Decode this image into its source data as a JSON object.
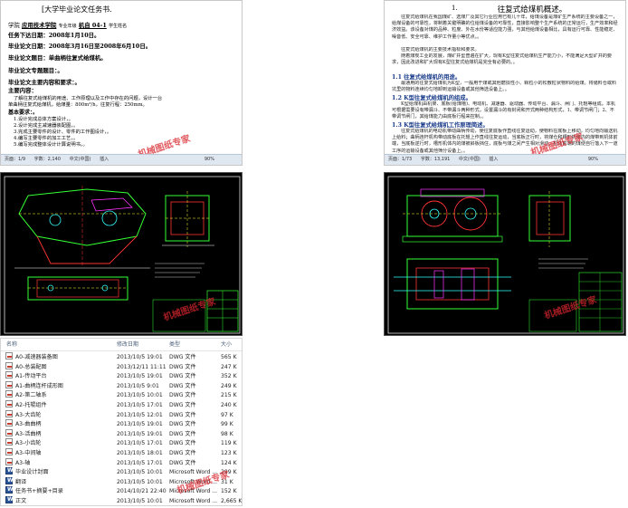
{
  "top_left_doc": {
    "title": "[大学毕业论文任务书.",
    "lines": [
      {
        "label": "学院",
        "value": "应用技术学院",
        "label2": "专业年级",
        "value2": "机自 04-1",
        "label3": "学生姓名"
      },
      {
        "text": "任务下达日期：2008年1月10日。"
      },
      {
        "text": "毕业论文日期：2008年3月16日至2008年6月10日。"
      },
      {
        "text": "毕业论文题目：单曲柄往复式给煤机。"
      },
      {
        "text": "毕业论文专题题目：。"
      },
      {
        "text": "毕业论文主要内容和要求：。"
      },
      {
        "text": "主要内容："
      }
    ],
    "content_lines": [
      "了解往复式给煤机的用途、工作原理以及工作中存在的问题，设计一台",
      "单曲柄往复式给煤机，给煤量：800m³/h，往复行程：250mm。"
    ],
    "requirements_head": "基本要求：。",
    "requirements": [
      "1.设计完成总体方案设计，。",
      "2.设计完成主减速器装配图，。",
      "3.完成主要零件的设计、零件的工作图设计，。",
      "4.编写主要零件的加工工艺，。",
      "5.编写完成整体设计计算说明书。。"
    ],
    "status": [
      "页面：1/9",
      "字数：2,140",
      "中文(中国)",
      "插入",
      "90%"
    ]
  },
  "top_right_doc": {
    "page_marker": "1.",
    "title": "往复式给煤机概述。",
    "para1": "往复式给煤机在我国煤矿、选煤厂及其它行业应用已有几十年，给煤设备是煤矿生产系统的主要设备之一，给煤设备的可靠性，将制着关键明确的位给煤设备的可靠性，直接影响整个生产系统的正常运行，生产效率和经济效益。该设备对煤的品种、粒度、外在水份等适应能力强，与其他给煤设备相比，具有运行可靠、性能稳定、噪音低、安全可靠、维护工作量小等优点。。",
    "para2": "往复式给煤机的主要技术指标和要求。",
    "para3": "随着煤炭工业的发展，煤矿井型普遍在扩大，现有K型往复式给煤机生产能力小，不能满足大型矿井的要求，因此改进和扩大现有K型往复式给煤机是完全有必要的。。",
    "h1": "1.1 往复式给煤机的用途。",
    "para4": "最通用的往复式给煤机为K型，一般用于煤或其他磨损性小、颗粒小的松散粒状物料的给煤。将储料仓或料坑里的物料连续均匀地卸到运输设备或其他筛选设备上。。",
    "h2": "1.2 K型往复式给煤机的组成。",
    "para5": "K型给煤机由机架、底板(给煤槽)、电动机、减速器、驱动器、传动平台、漏斗、闸门、托辊等组成。本机可根据需要设有带漏斗、不带漏斗两种形式，设置漏斗的有封闭和开式两种结构形式，1、带调节闸门；2、不带调节闸门，其给煤能力由底板行程来控制。。",
    "h3": "1.3 K型往复式给煤机工作原理简述。",
    "para6": "往复式给煤机的电动机带动曲柄传动，使往复底板作直线往复运动，使物料在底板上移动，均匀地向输送机上给料；曲柄连杆机构带动底板在托辊上作直线往复运动，当底板正行时，将煤仓和槽形机体内的煤带到机体前端，当底板逆行时，槽形机体内的煤被斜板挡住，底板与煤之间产生相对滑动，机体前端的煤便自行落入下一道工序的运输设备或其他筛分设备上。。",
    "status": [
      "页面：1/73",
      "字数：13,191",
      "中文(中国)",
      "插入",
      "90%"
    ]
  },
  "watermark_text": "机械图纸专家",
  "explorer": {
    "columns": [
      "名称",
      "修改日期",
      "类型",
      "大小"
    ],
    "files": [
      {
        "name": "A0-减速器装备图",
        "date": "2013/10/5 19:01",
        "type": "DWG 文件",
        "size": "565 K",
        "icon": "dwg"
      },
      {
        "name": "A0-总装配图",
        "date": "2013/12/11 11:11",
        "type": "DWG 文件",
        "size": "247 K",
        "icon": "dwg"
      },
      {
        "name": "A1-传动平台",
        "date": "2013/10/5 19:01",
        "type": "DWG 文件",
        "size": "352 K",
        "icon": "dwg"
      },
      {
        "name": "A1-曲柄连杆成形图",
        "date": "2013/10/5 9:01",
        "type": "DWG 文件",
        "size": "249 K",
        "icon": "dwg"
      },
      {
        "name": "A2-第二轴系",
        "date": "2013/10/5 10:01",
        "type": "DWG 文件",
        "size": "215 K",
        "icon": "dwg"
      },
      {
        "name": "A2-托辊组件",
        "date": "2013/10/5 17:01",
        "type": "DWG 文件",
        "size": "240 K",
        "icon": "dwg"
      },
      {
        "name": "A3-大齿轮",
        "date": "2013/10/5 12:01",
        "type": "DWG 文件",
        "size": "97 K",
        "icon": "dwg"
      },
      {
        "name": "A3-曲曲柄",
        "date": "2013/10/5 19:01",
        "type": "DWG 文件",
        "size": "99 K",
        "icon": "dwg"
      },
      {
        "name": "A3-活曲柄",
        "date": "2013/10/5 19:01",
        "type": "DWG 文件",
        "size": "98 K",
        "icon": "dwg"
      },
      {
        "name": "A3-小齿轮",
        "date": "2013/10/5 17:01",
        "type": "DWG 文件",
        "size": "119 K",
        "icon": "dwg"
      },
      {
        "name": "A3-中间轴",
        "date": "2013/10/5 18:01",
        "type": "DWG 文件",
        "size": "123 K",
        "icon": "dwg"
      },
      {
        "name": "A3-轴",
        "date": "2013/10/5 17:01",
        "type": "DWG 文件",
        "size": "124 K",
        "icon": "dwg"
      },
      {
        "name": "毕业设计封面",
        "date": "2013/10/5 10:01",
        "type": "Microsoft Word ...",
        "size": "299 K",
        "icon": "word"
      },
      {
        "name": "翻译",
        "date": "2013/10/5 10:01",
        "type": "Microsoft Word ...",
        "size": "31 K",
        "icon": "word"
      },
      {
        "name": "任务书+摘要+目录",
        "date": "2014/10/21 22:40",
        "type": "Microsoft Word ...",
        "size": "152 K",
        "icon": "word"
      },
      {
        "name": "正文",
        "date": "2013/10/5 10:01",
        "type": "Microsoft Word ...",
        "size": "2,665 K",
        "icon": "word"
      }
    ]
  }
}
